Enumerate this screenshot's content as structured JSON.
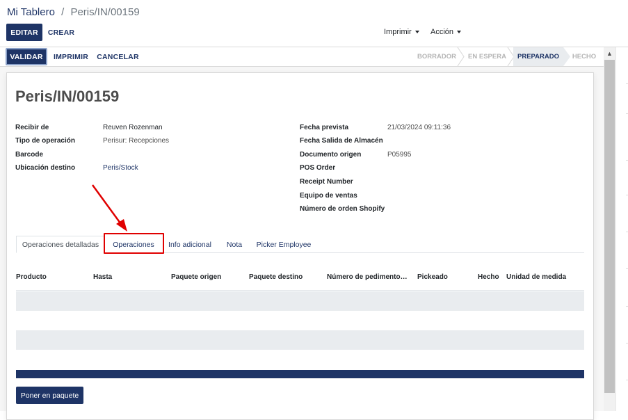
{
  "breadcrumb": {
    "parent": "Mi Tablero",
    "separator": "/",
    "current": "Peris/IN/00159"
  },
  "control": {
    "edit": "EDITAR",
    "create": "CREAR",
    "print_menu": "Imprimir",
    "action_menu": "Acción"
  },
  "actions": {
    "validate": "VALIDAR",
    "print": "IMPRIMIR",
    "cancel": "CANCELAR"
  },
  "stages": [
    {
      "label": "BORRADOR",
      "active": false
    },
    {
      "label": "EN ESPERA",
      "active": false
    },
    {
      "label": "PREPARADO",
      "active": true
    },
    {
      "label": "HECHO",
      "active": false
    }
  ],
  "record": {
    "title": "Peris/IN/00159",
    "left_fields": [
      {
        "label": "Recibir de",
        "value": "Reuven Rozenman"
      },
      {
        "label": "Tipo de operación",
        "value": "Perisur: Recepciones"
      },
      {
        "label": "Barcode",
        "value": ""
      },
      {
        "label": "Ubicación destino",
        "value": "Peris/Stock"
      }
    ],
    "right_fields": [
      {
        "label": "Fecha prevista",
        "value": "21/03/2024 09:11:36"
      },
      {
        "label": "Fecha Salida de Almacén",
        "value": ""
      },
      {
        "label": "Documento origen",
        "value": "P05995"
      },
      {
        "label": "POS Order",
        "value": ""
      },
      {
        "label": "Receipt Number",
        "value": ""
      },
      {
        "label": "Equipo de ventas",
        "value": ""
      },
      {
        "label": "Número de orden Shopify",
        "value": ""
      }
    ]
  },
  "tabs": [
    {
      "label": "Operaciones detalladas",
      "active": true
    },
    {
      "label": "Operaciones",
      "active": false,
      "highlighted": true
    },
    {
      "label": "Info adicional",
      "active": false
    },
    {
      "label": "Nota",
      "active": false
    },
    {
      "label": "Picker Employee",
      "active": false
    }
  ],
  "table": {
    "columns": [
      "Producto",
      "Hasta",
      "Paquete origen",
      "Paquete destino",
      "Número de pedimento…",
      "Pickeado",
      "Hecho",
      "Unidad de medida"
    ]
  },
  "put_in_pack": "Poner en paquete",
  "colors": {
    "primary": "#1e3466",
    "annotation": "#e00000",
    "active_stage_bg": "#e9ecef"
  },
  "annotation": {
    "type": "arrow",
    "target": "tab-operaciones"
  }
}
